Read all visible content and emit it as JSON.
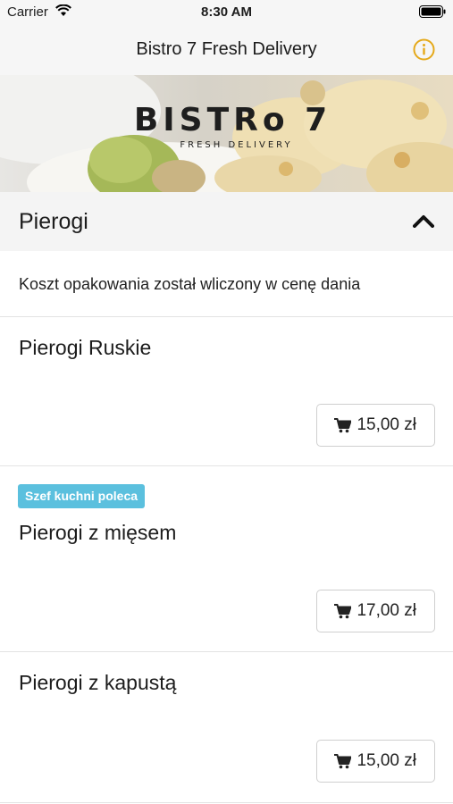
{
  "status_bar": {
    "carrier": "Carrier",
    "time": "8:30 AM"
  },
  "nav": {
    "title": "Bistro 7 Fresh Delivery",
    "info_icon": "info-icon"
  },
  "hero": {
    "logo_text": "BISTRo 7",
    "logo_subtext": "FRESH DELIVERY"
  },
  "section": {
    "title": "Pierogi",
    "state": "expanded",
    "chevron_icon": "chevron-up-icon"
  },
  "note": {
    "text": "Koszt opakowania został wliczony w cenę dania"
  },
  "items": [
    {
      "name": "Pierogi Ruskie",
      "badge": "",
      "price": "15,00 zł"
    },
    {
      "name": "Pierogi z mięsem",
      "badge": "Szef kuchni poleca",
      "price": "17,00 zł"
    },
    {
      "name": "Pierogi z kapustą",
      "badge": "",
      "price": "15,00 zł"
    }
  ],
  "colors": {
    "accent": "#e5a91a",
    "badge": "#5bc0de",
    "header_bg": "#f6f6f6"
  }
}
